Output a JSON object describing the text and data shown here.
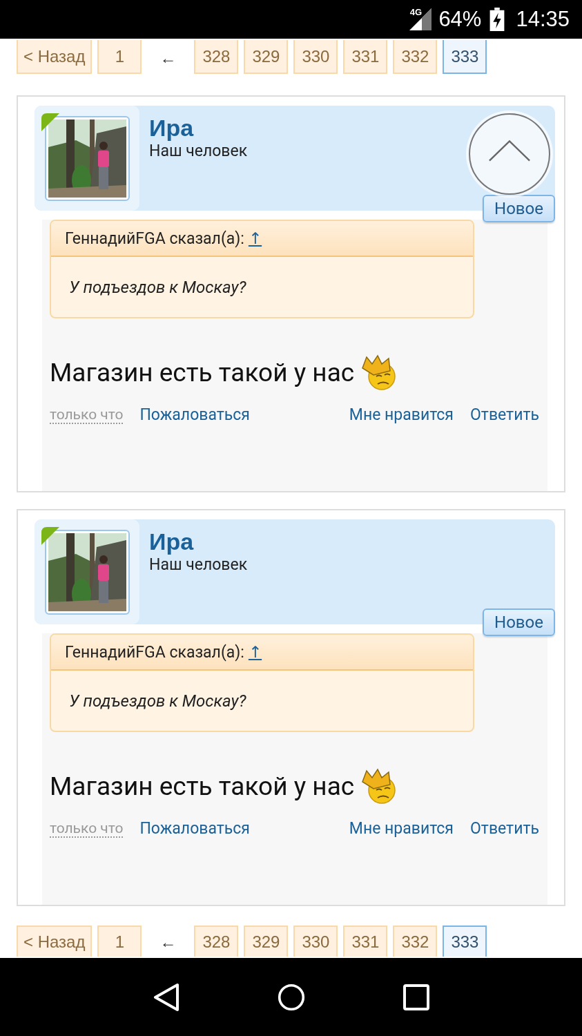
{
  "status_bar": {
    "network": "4G",
    "battery": "64%",
    "time": "14:35"
  },
  "pagination_top": [
    {
      "kind": "prev",
      "label": "< Назад",
      "selected": false
    },
    {
      "kind": "page",
      "label": "1",
      "selected": false
    },
    {
      "kind": "gap",
      "label": "←"
    },
    {
      "kind": "page",
      "label": "328",
      "selected": false
    },
    {
      "kind": "page",
      "label": "329",
      "selected": false
    },
    {
      "kind": "page",
      "label": "330",
      "selected": false
    },
    {
      "kind": "page",
      "label": "331",
      "selected": false
    },
    {
      "kind": "page",
      "label": "332",
      "selected": false
    },
    {
      "kind": "page",
      "label": "333",
      "selected": true
    }
  ],
  "posts": [
    {
      "author": "Ира",
      "role": "Наш человек",
      "new_label": "Новое",
      "quote": {
        "author_line": "ГеннадийFGA сказал(а):",
        "link": "↑",
        "text": "У подъездов к Москау?"
      },
      "message": "Магазин есть такой у нас",
      "time": "только что",
      "actions": [
        "Пожаловаться",
        "Мне нравится",
        "Ответить"
      ]
    },
    {
      "author": "Ира",
      "role": "Наш человек",
      "new_label": "Новое",
      "quote": {
        "author_line": "ГеннадийFGA сказал(а):",
        "link": "↑",
        "text": "У подъездов к Москау?"
      },
      "message": "Магазин есть такой у нас",
      "time": "только что",
      "actions": [
        "Пожаловаться",
        "Мне нравится",
        "Ответить"
      ]
    }
  ],
  "pagination_bottom": [
    {
      "kind": "prev",
      "label": "< Назад",
      "selected": false
    },
    {
      "kind": "page",
      "label": "1",
      "selected": false
    },
    {
      "kind": "gap",
      "label": "←"
    },
    {
      "kind": "page",
      "label": "328",
      "selected": false
    },
    {
      "kind": "page",
      "label": "329",
      "selected": false
    },
    {
      "kind": "page",
      "label": "330",
      "selected": false
    },
    {
      "kind": "page",
      "label": "331",
      "selected": false
    },
    {
      "kind": "page",
      "label": "332",
      "selected": false
    },
    {
      "kind": "page",
      "label": "333",
      "selected": true
    }
  ]
}
